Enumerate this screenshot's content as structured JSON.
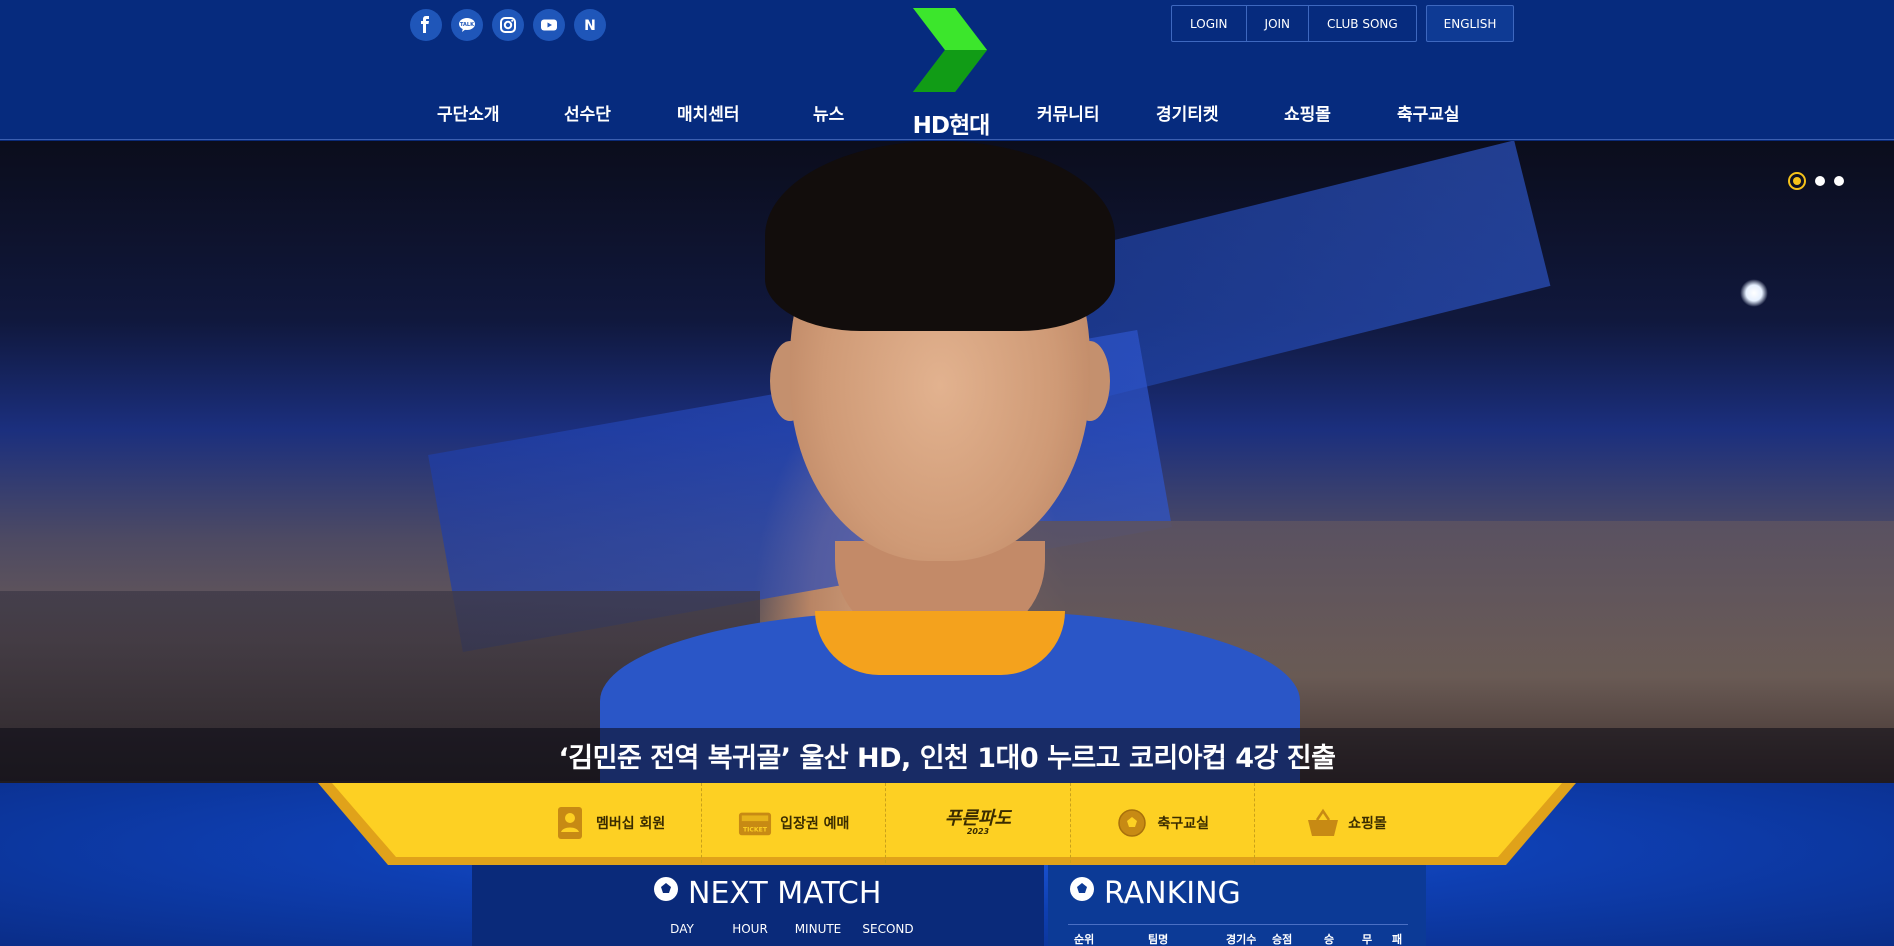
{
  "header": {
    "social": [
      {
        "name": "facebook-icon"
      },
      {
        "name": "kakaotalk-icon",
        "text": "TALK"
      },
      {
        "name": "instagram-icon"
      },
      {
        "name": "youtube-icon"
      },
      {
        "name": "naver-icon",
        "text": "N"
      }
    ],
    "top_links": [
      "LOGIN",
      "JOIN",
      "CLUB SONG"
    ],
    "english": "ENGLISH",
    "logo_text": "HD현대",
    "nav": [
      "구단소개",
      "선수단",
      "매치센터",
      "뉴스",
      "커뮤니티",
      "경기티켓",
      "쇼핑몰",
      "축구교실"
    ]
  },
  "hero": {
    "caption": "‘김민준 전역 복귀골’ 울산 HD, 인천 1대0 누르고 코리아컵 4강 진출",
    "slides": 3,
    "active_slide": 1
  },
  "quick_menu": {
    "items": [
      "멤버십 회원",
      "입장권 예매",
      "푸른파도",
      "축구교실",
      "쇼핑몰"
    ],
    "purple_wave_sub": "2023",
    "ticket_icon_text": "TICKET"
  },
  "next_match": {
    "title": "NEXT MATCH",
    "units": [
      "DAY",
      "HOUR",
      "MINUTE",
      "SECOND"
    ]
  },
  "ranking": {
    "title": "RANKING",
    "columns": [
      "순위",
      "팀명",
      "경기수",
      "승점",
      "승",
      "무",
      "패"
    ]
  },
  "colors": {
    "header_bg": "#062b7e",
    "accent_yellow": "#fdd023",
    "logo_green": "#26c321"
  }
}
